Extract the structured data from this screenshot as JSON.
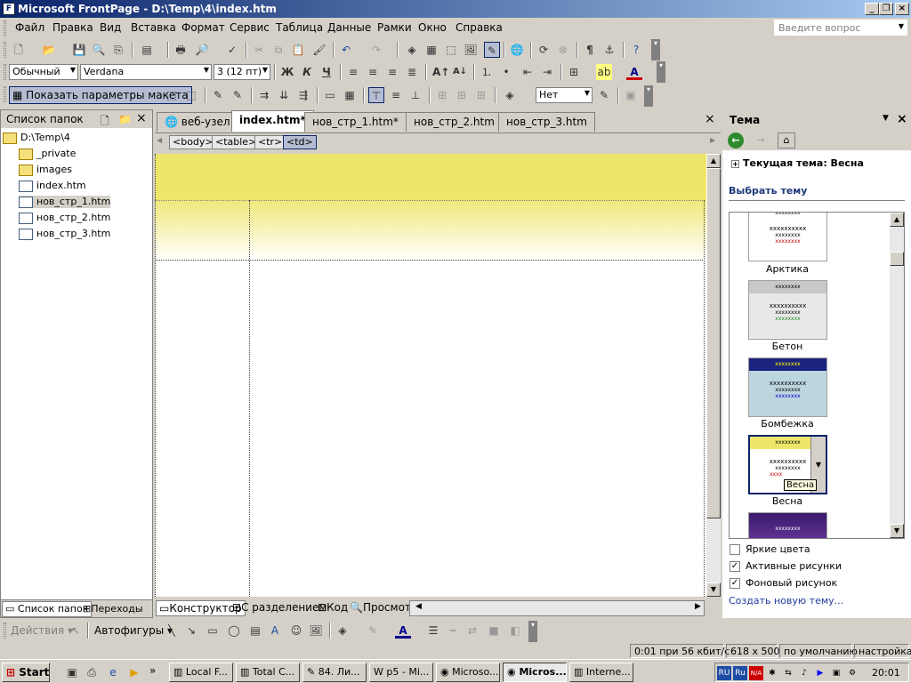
{
  "window": {
    "title": "Microsoft FrontPage - D:\\Temp\\4\\index.htm",
    "help_placeholder": "Введите вопрос"
  },
  "menu": [
    "Файл",
    "Правка",
    "Вид",
    "Вставка",
    "Формат",
    "Сервис",
    "Таблица",
    "Данные",
    "Рамки",
    "Окно",
    "Справка"
  ],
  "formatting": {
    "style": "Обычный",
    "font": "Verdana",
    "size": "3 (12 пт)",
    "bold": "Ж",
    "italic": "К",
    "underline": "Ч"
  },
  "layout_bar": {
    "show_layout_label": "Показать параметры макета",
    "fill_combo": "Нет"
  },
  "folder_panel": {
    "title": "Список папок",
    "root": "D:\\Temp\\4",
    "items": [
      "_private",
      "images",
      "index.htm",
      "нов_стр_1.htm",
      "нов_стр_2.htm",
      "нов_стр_3.htm"
    ],
    "bottom_tabs": [
      "Список папок",
      "Переходы"
    ]
  },
  "editor": {
    "tabs": [
      "веб-узел",
      "index.htm*",
      "нов_стр_1.htm*",
      "нов_стр_2.htm",
      "нов_стр_3.htm"
    ],
    "tags": [
      "<body>",
      "<table>",
      "<tr>",
      "<td>"
    ],
    "view_tabs": [
      "Конструктор",
      "С разделением",
      "Код",
      "Просмотр"
    ]
  },
  "task_pane": {
    "title": "Тема",
    "current_theme": "Текущая тема: Весна",
    "choose_label": "Выбрать тему",
    "themes": [
      {
        "name": "Арктика"
      },
      {
        "name": "Бетон"
      },
      {
        "name": "Бомбежка"
      },
      {
        "name": "Весна",
        "tooltip": "Весна"
      }
    ],
    "preview_text": "xxxxxxxx",
    "preview_big": "xxxxxxxxxx",
    "preview_small": "xxxx",
    "options": [
      {
        "label": "Яркие цвета",
        "checked": false
      },
      {
        "label": "Активные рисунки",
        "checked": true
      },
      {
        "label": "Фоновый рисунок",
        "checked": true
      }
    ],
    "create_link": "Создать новую тему..."
  },
  "drawing": {
    "actions": "Действия",
    "autoshapes": "Автофигуры"
  },
  "status": [
    "0:01 при 56 кбит/с",
    "618 x 500",
    "по умолчанию",
    "настройка"
  ],
  "taskbar": {
    "start": "Start",
    "buttons": [
      "Local F...",
      "Total C...",
      "84. Ли...",
      "p5 - Mi...",
      "Microso...",
      "Micros...",
      "Interne..."
    ],
    "tray_langs": [
      "RU",
      "Ru",
      "N/A"
    ],
    "clock": "20:01"
  }
}
